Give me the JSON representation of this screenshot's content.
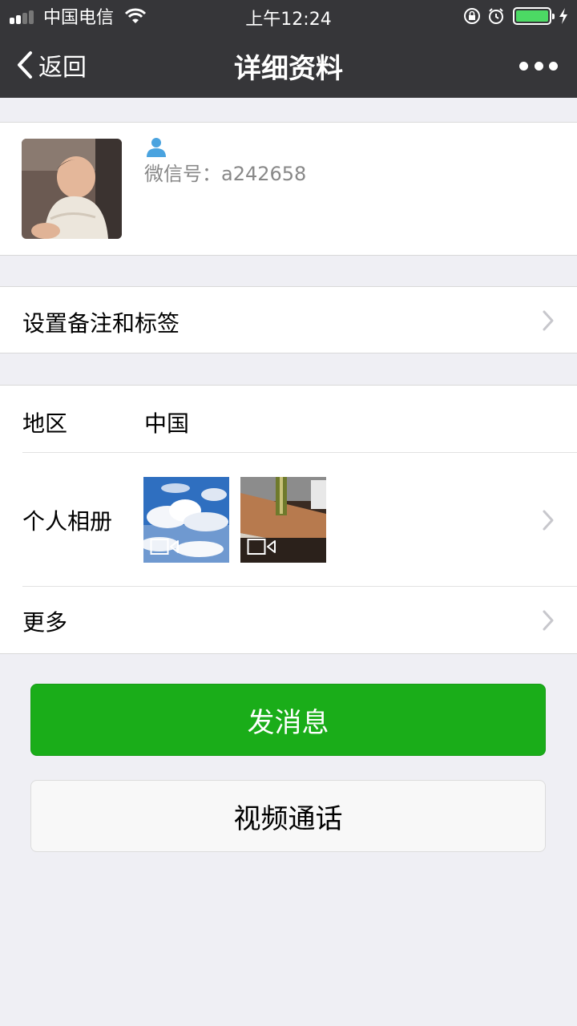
{
  "status_bar": {
    "carrier": "中国电信",
    "time": "上午12:24"
  },
  "nav": {
    "back_label": "返回",
    "title": "详细资料"
  },
  "profile": {
    "wechat_id": "微信号：a242658"
  },
  "rows": {
    "remark_label": "设置备注和标签",
    "region_label": "地区",
    "region_value": "中国",
    "album_label": "个人相册",
    "more_label": "更多"
  },
  "buttons": {
    "send_message": "发消息",
    "video_call": "视频通话"
  },
  "colors": {
    "header_bg": "#363639",
    "primary_button": "#1aad19",
    "page_bg": "#efeff4"
  }
}
